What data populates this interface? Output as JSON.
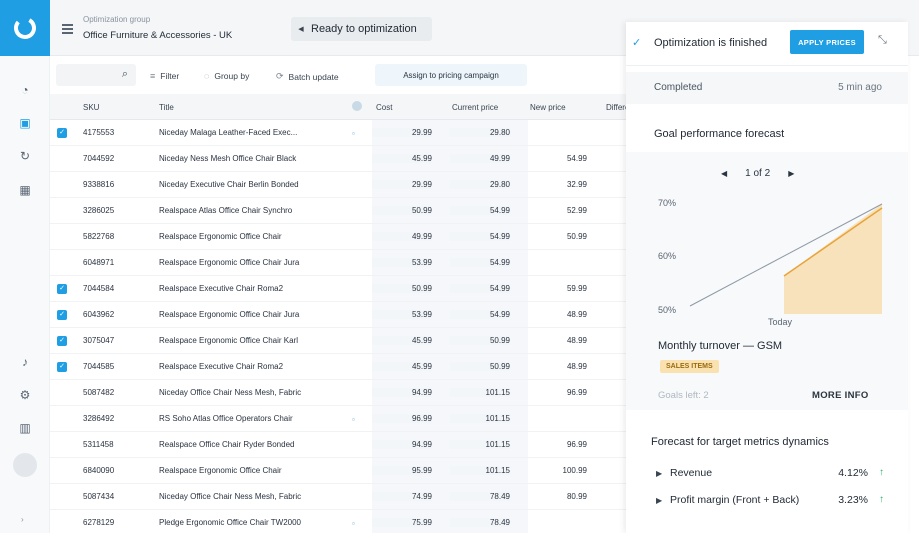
{
  "header": {
    "group_label": "Optimization group",
    "group_name": "Office Furniture & Accessories - UK",
    "status": "Ready to optimization"
  },
  "toolbar": {
    "search_placeholder": "",
    "filter": "Filter",
    "group_by": "Group by",
    "batch_update": "Batch update",
    "assign": "Assign to pricing campaign"
  },
  "table": {
    "headers": {
      "sku": "SKU",
      "title": "Title",
      "cost": "Cost",
      "current_price": "Current price",
      "new_price": "New price",
      "difference": "Differen"
    },
    "rows": [
      {
        "checked": true,
        "sku": "4175553",
        "title": "Niceday Malaga Leather-Faced Exec...",
        "flag": true,
        "cost": "29.99",
        "current": "29.80",
        "new": "",
        "dir": ""
      },
      {
        "checked": false,
        "sku": "7044592",
        "title": "Niceday Ness Mesh Office Chair Black",
        "flag": false,
        "cost": "45.99",
        "current": "49.99",
        "new": "54.99",
        "dir": "up"
      },
      {
        "checked": false,
        "sku": "9338816",
        "title": "Niceday Executive Chair Berlin Bonded",
        "flag": false,
        "cost": "29.99",
        "current": "29.80",
        "new": "32.99",
        "dir": "up"
      },
      {
        "checked": false,
        "sku": "3286025",
        "title": "Realspace Atlas Office Chair Synchro",
        "flag": false,
        "cost": "50.99",
        "current": "54.99",
        "new": "52.99",
        "dir": "down"
      },
      {
        "checked": false,
        "sku": "5822768",
        "title": "Realspace Ergonomic Office Chair",
        "flag": false,
        "cost": "49.99",
        "current": "54.99",
        "new": "50.99",
        "dir": "down"
      },
      {
        "checked": false,
        "sku": "6048971",
        "title": "Realspace Ergonomic Office Chair Jura",
        "flag": false,
        "cost": "53.99",
        "current": "54.99",
        "new": "",
        "dir": ""
      },
      {
        "checked": true,
        "sku": "7044584",
        "title": "Realspace Executive Chair Roma2",
        "flag": false,
        "cost": "50.99",
        "current": "54.99",
        "new": "59.99",
        "dir": "up"
      },
      {
        "checked": true,
        "sku": "6043962",
        "title": "Realspace Ergonomic Office Chair Jura",
        "flag": false,
        "cost": "53.99",
        "current": "54.99",
        "new": "48.99",
        "dir": "down"
      },
      {
        "checked": true,
        "sku": "3075047",
        "title": "Realspace Ergonomic Office Chair Karl",
        "flag": false,
        "cost": "45.99",
        "current": "50.99",
        "new": "48.99",
        "dir": "down"
      },
      {
        "checked": true,
        "sku": "7044585",
        "title": "Realspace Executive Chair Roma2",
        "flag": false,
        "cost": "45.99",
        "current": "50.99",
        "new": "48.99",
        "dir": "down"
      },
      {
        "checked": false,
        "sku": "5087482",
        "title": "Niceday Office Chair Ness Mesh, Fabric",
        "flag": false,
        "cost": "94.99",
        "current": "101.15",
        "new": "96.99",
        "dir": "down"
      },
      {
        "checked": false,
        "sku": "3286492",
        "title": "RS Soho Atlas Office Operators Chair",
        "flag": true,
        "cost": "96.99",
        "current": "101.15",
        "new": "",
        "dir": ""
      },
      {
        "checked": false,
        "sku": "5311458",
        "title": "Realspace Office Chair Ryder Bonded",
        "flag": false,
        "cost": "94.99",
        "current": "101.15",
        "new": "96.99",
        "dir": "down"
      },
      {
        "checked": false,
        "sku": "6840090",
        "title": "Realspace Ergonomic Office Chair",
        "flag": false,
        "cost": "95.99",
        "current": "101.15",
        "new": "100.99",
        "dir": "down"
      },
      {
        "checked": false,
        "sku": "5087434",
        "title": "Niceday Office Chair Ness Mesh, Fabric",
        "flag": false,
        "cost": "74.99",
        "current": "78.49",
        "new": "80.99",
        "dir": "up"
      },
      {
        "checked": false,
        "sku": "6278129",
        "title": "Pledge Ergonomic Office Chair TW2000",
        "flag": true,
        "cost": "75.99",
        "current": "78.49",
        "new": "",
        "dir": ""
      }
    ]
  },
  "panel": {
    "finished": "Optimization is finished",
    "apply": "APPLY PRICES",
    "completed_label": "Completed",
    "completed_time": "5 min ago",
    "goal_title": "Goal performance forecast",
    "pager": "1 of 2",
    "y_ticks": [
      "70%",
      "60%",
      "50%"
    ],
    "x_tick": "Today",
    "metric_name": "Monthly turnover — GSM",
    "badge": "SALES ITEMS",
    "goals_left": "Goals left: 2",
    "more_info": "MORE INFO",
    "forecast_title": "Forecast for target metrics dynamics",
    "metrics": [
      {
        "label": "Revenue",
        "value": "4.12%"
      },
      {
        "label": "Profit margin (Front + Back)",
        "value": "3.23%"
      }
    ]
  },
  "colors": {
    "accent": "#1f9ee3",
    "up": "#2fb36a",
    "down": "#e8a43a",
    "forecast_fill": "#f7d9a6"
  }
}
